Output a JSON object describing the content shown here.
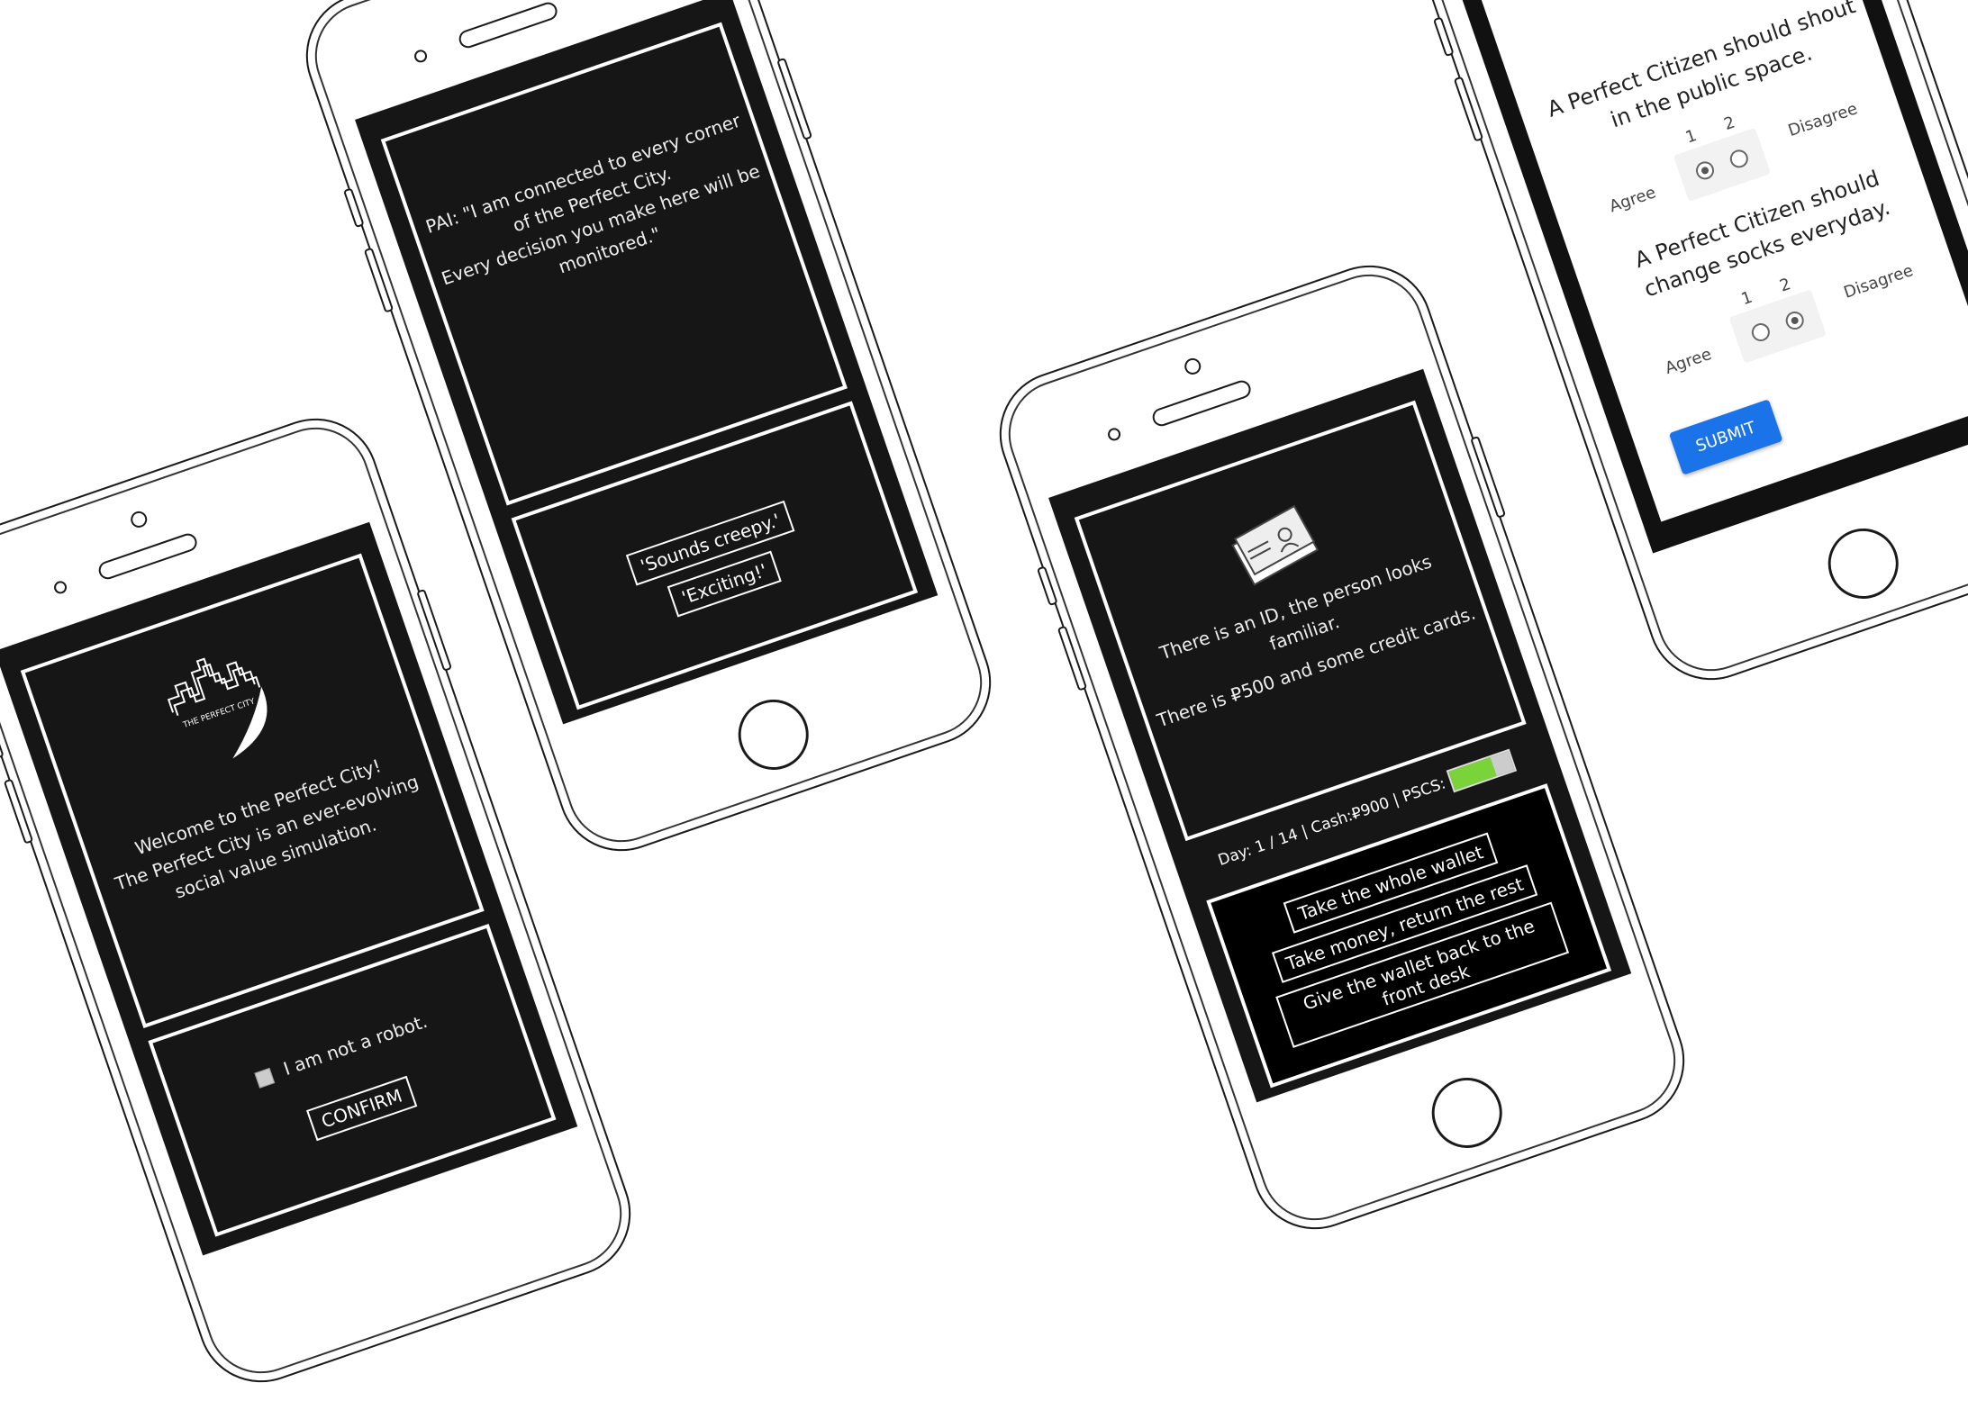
{
  "phone1": {
    "logo_text": "THE PERFECT CITY",
    "welcome_lines": [
      "Welcome to the Perfect City!",
      "The Perfect City is an ever-evolving",
      "social value simulation."
    ],
    "robot_label": "I am not a robot.",
    "confirm_label": "CONFIRM"
  },
  "phone2": {
    "message_lines": [
      "PAI: \"I am connected to every corner",
      "of the Perfect City.",
      "Every decision you make here will be",
      "monitored.\""
    ],
    "option1": "'Sounds creepy.'",
    "option2": "'Exciting!'"
  },
  "phone3": {
    "description_lines": [
      "There is an ID, the person looks",
      "familiar.",
      "There is ₽500 and some credit cards."
    ],
    "status": "Day: 1 / 14 | Cash:₽900 | PSCS:",
    "pscs_level": 0.7,
    "choice1": "Take the whole wallet",
    "choice2": "Take money, return the rest",
    "choice3": "Give the wallet back to the front desk"
  },
  "phone4": {
    "q1_text": "A Perfect Citizen should shout in the public space.",
    "q2_text": "A Perfect Citizen should change socks everyday.",
    "scale_num1": "1",
    "scale_num2": "2",
    "agree_label": "Agree",
    "disagree_label": "Disagree",
    "submit_label": "SUBMIT",
    "q1_selected": 1,
    "q2_selected": 2
  },
  "colors": {
    "screen_bg": "#161616",
    "submit_blue": "#1a73e8",
    "battery_green": "#7bd33a"
  }
}
